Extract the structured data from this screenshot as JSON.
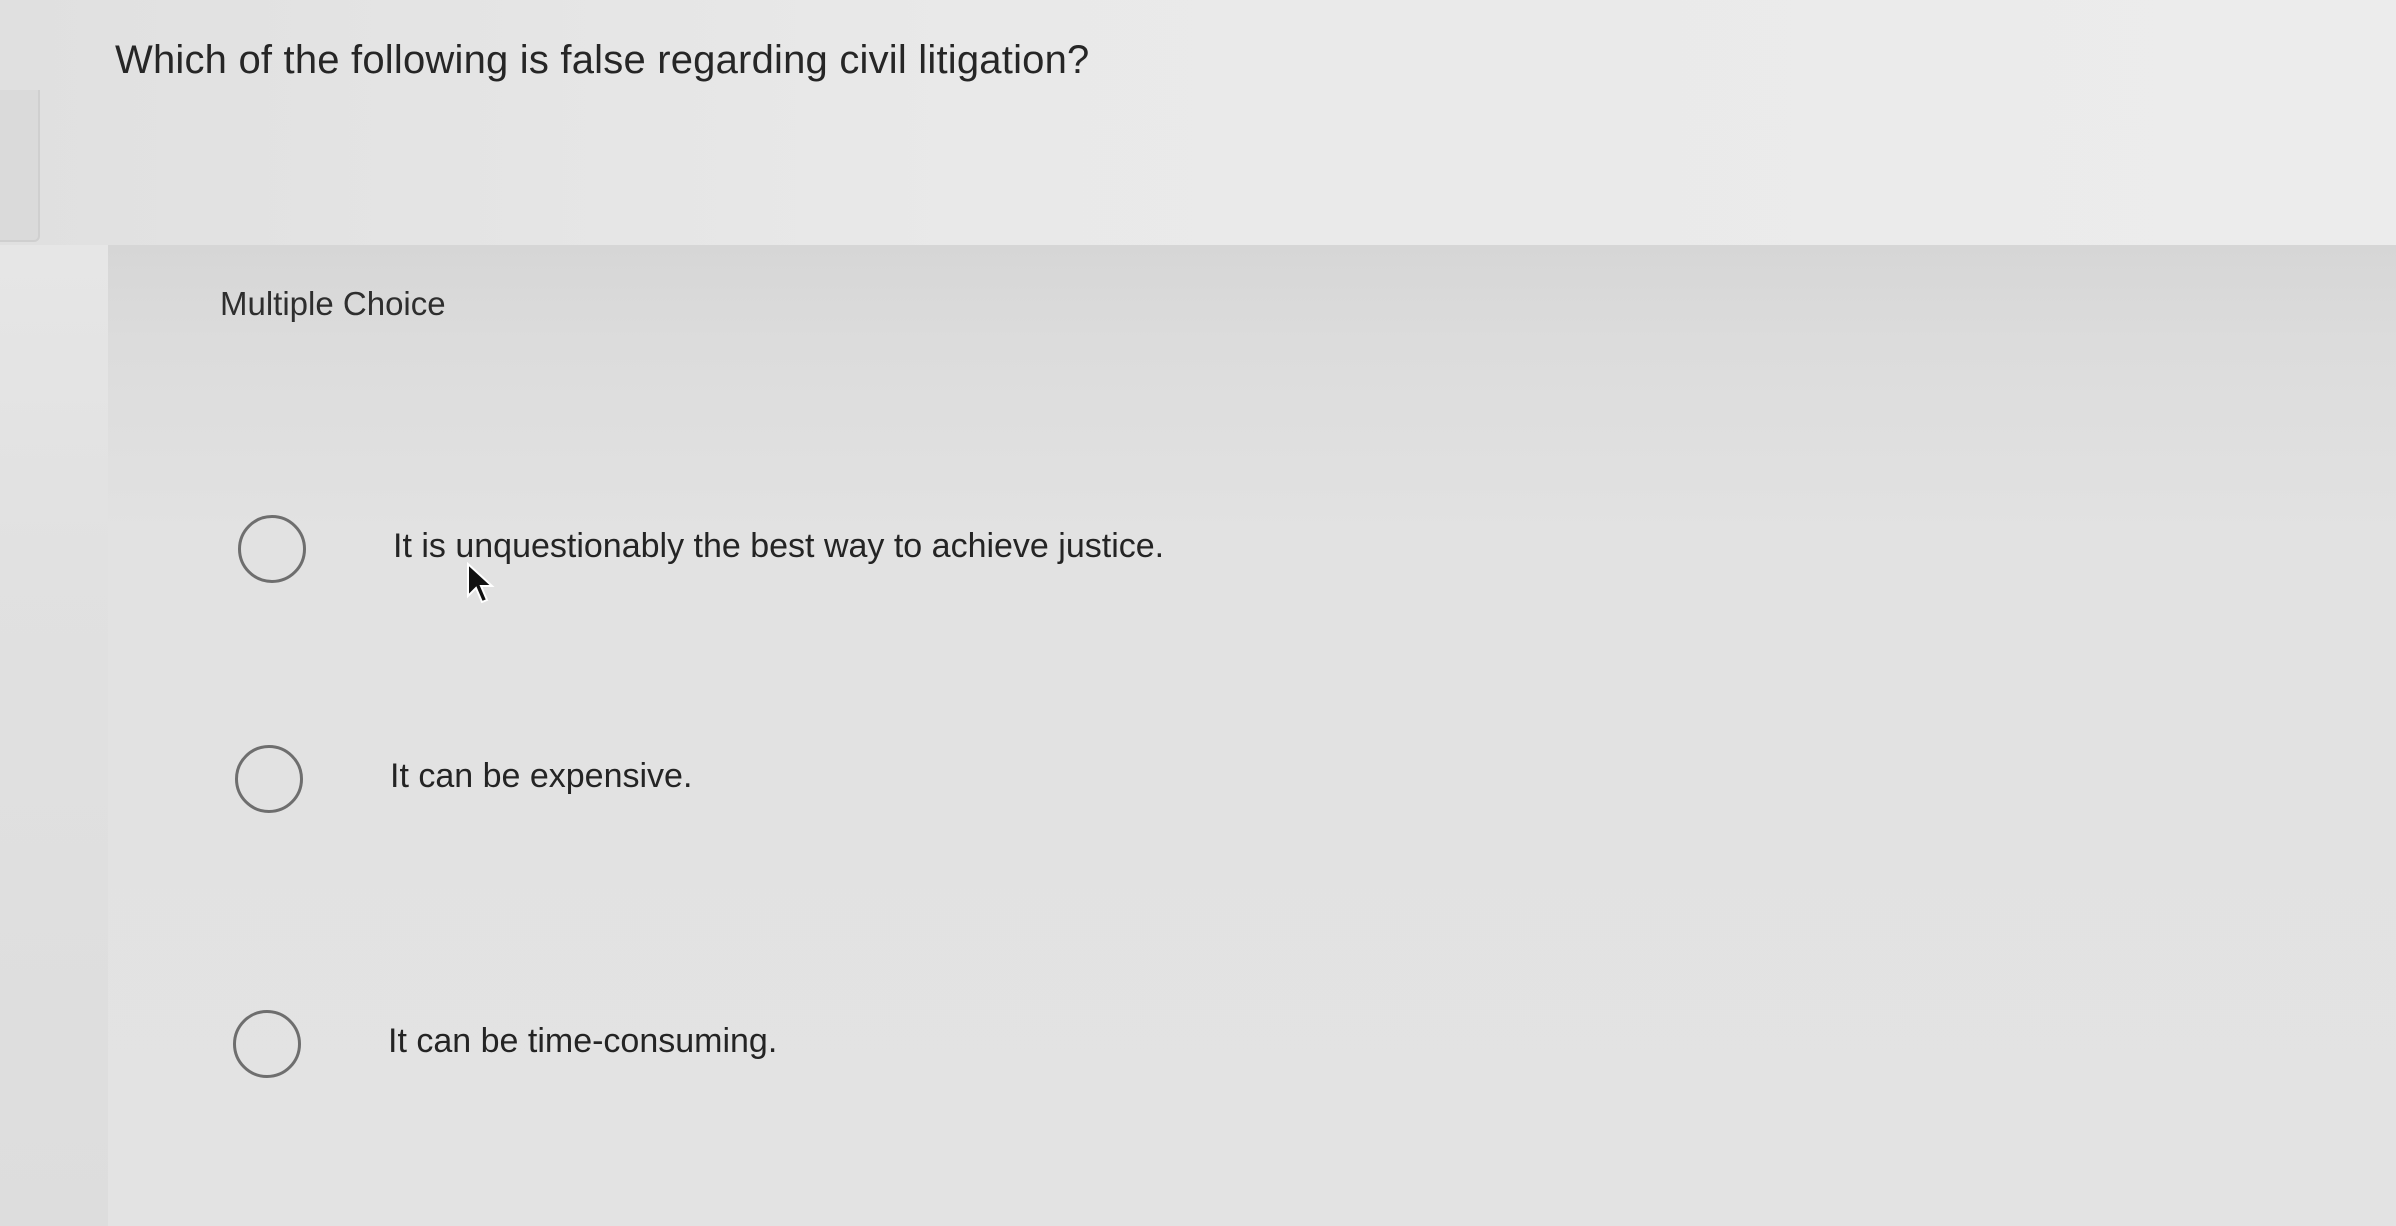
{
  "question": {
    "text": "Which of the following is false regarding civil litigation?"
  },
  "panel": {
    "label": "Multiple Choice",
    "options": [
      {
        "label": "It is unquestionably the best way to achieve justice.",
        "selected": false
      },
      {
        "label": "It can be expensive.",
        "selected": false
      },
      {
        "label": "It can be time-consuming.",
        "selected": false
      }
    ]
  },
  "icons": {
    "radio": "radio-unselected-icon",
    "cursor": "mouse-pointer-icon"
  },
  "colors": {
    "text": "#262626",
    "radio_border": "#6e6e6e",
    "background": "#e3e3e3"
  }
}
